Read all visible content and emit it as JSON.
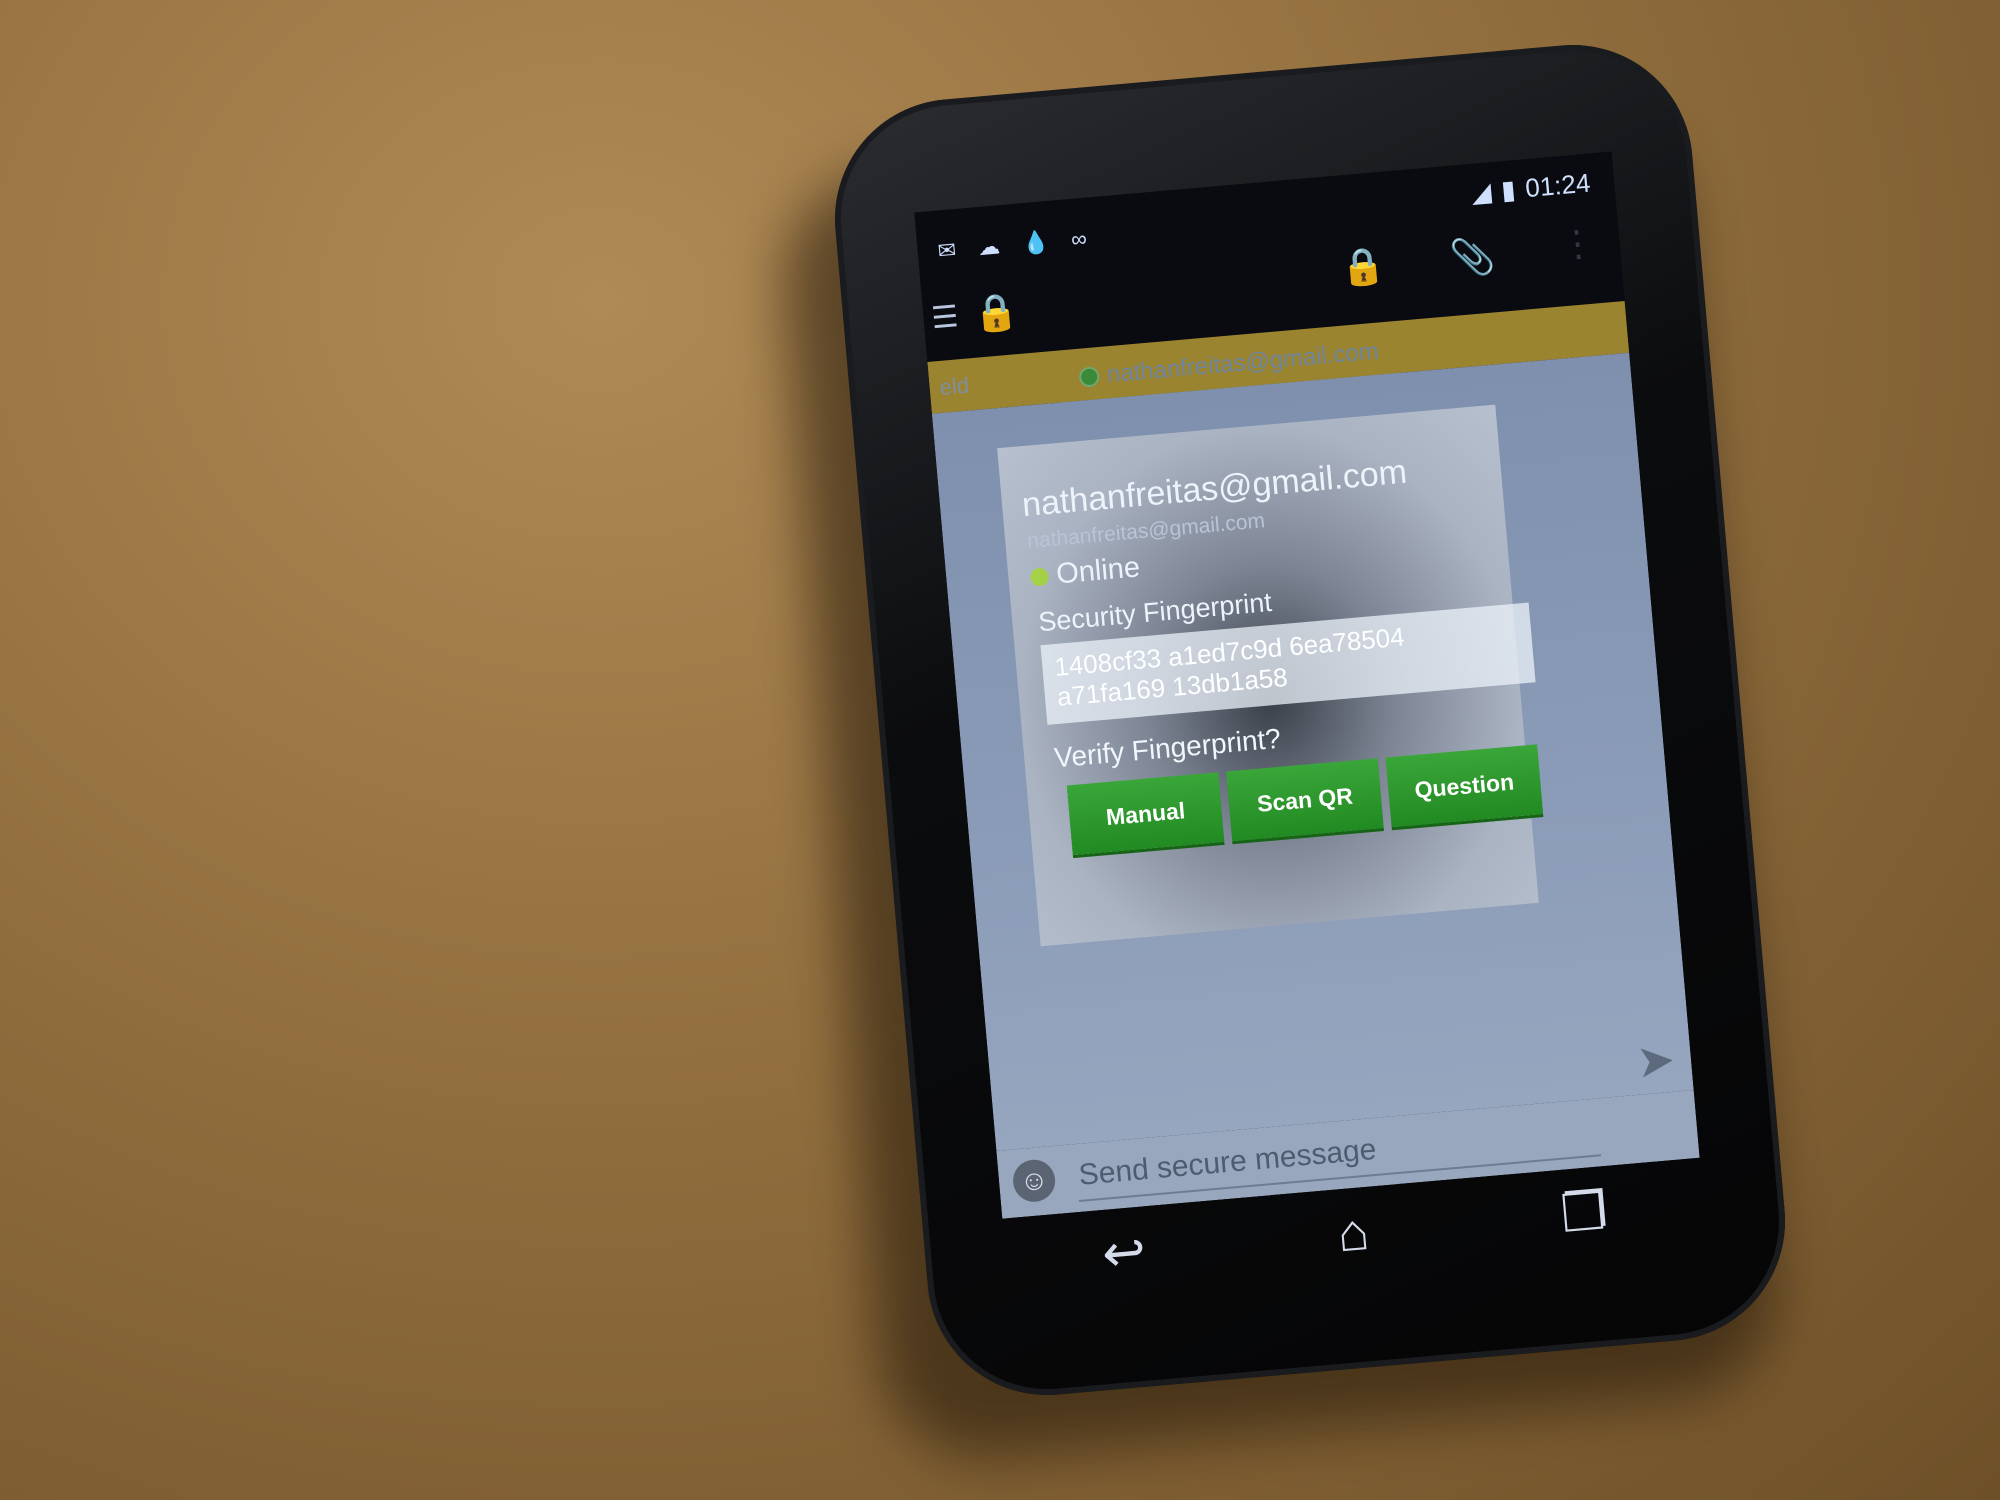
{
  "status_bar": {
    "time": "01:24",
    "left_icons": [
      "mail-icon",
      "notification-icon",
      "drop-icon",
      "voicemail-icon"
    ],
    "right_icons": [
      "signal-icon",
      "battery-icon"
    ]
  },
  "action_bar": {
    "icons": [
      "menu-icon",
      "app-lock-icon",
      "lock-icon",
      "attach-icon",
      "overflow-icon"
    ]
  },
  "tabs": {
    "partial_label": "eld",
    "active_label": "nathanfreitas@gmail.com"
  },
  "card": {
    "name": "nathanfreitas@gmail.com",
    "address": "nathanfreitas@gmail.com",
    "presence": "Online",
    "fingerprint_label": "Security Fingerprint",
    "fingerprint_line1": "1408cf33 a1ed7c9d 6ea78504",
    "fingerprint_line2": "a71fa169 13db1a58",
    "verify_label": "Verify Fingerprint?",
    "buttons": [
      "Manual",
      "Scan QR",
      "Question"
    ]
  },
  "composer": {
    "placeholder": "Send secure message"
  },
  "colors": {
    "accent_green": "#2a962a",
    "tab_gold": "#9b8430",
    "online": "#a5d146"
  }
}
